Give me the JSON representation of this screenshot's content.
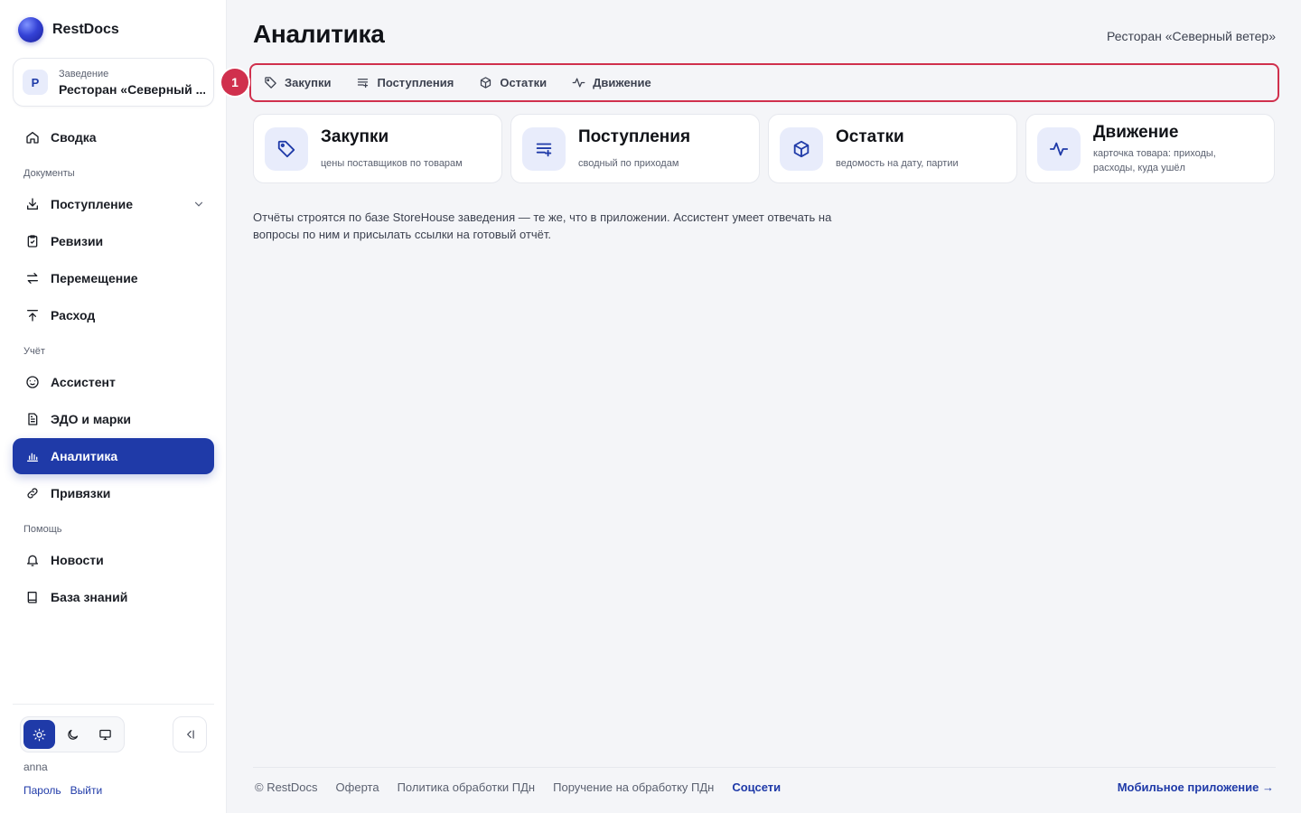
{
  "app": {
    "name": "RestDocs"
  },
  "venue": {
    "label": "Заведение",
    "avatar_letter": "Р",
    "name": "Ресторан «Северный ..."
  },
  "sidebar": {
    "summary": {
      "label": "Сводка",
      "icon": "home-icon"
    },
    "sections": {
      "documents": "Документы",
      "accounting": "Учёт",
      "help": "Помощь"
    },
    "items": [
      {
        "label": "Поступление",
        "icon": "download-icon"
      },
      {
        "label": "Ревизии",
        "icon": "clipboard-check-icon"
      },
      {
        "label": "Перемещение",
        "icon": "transfer-arrows-icon"
      },
      {
        "label": "Расход",
        "icon": "upload-icon"
      },
      {
        "label": "Ассистент",
        "icon": "assistant-icon"
      },
      {
        "label": "ЭДО и марки",
        "icon": "document-icon"
      },
      {
        "label": "Аналитика",
        "icon": "bar-chart-icon",
        "active": true
      },
      {
        "label": "Привязки",
        "icon": "link-icon"
      },
      {
        "label": "Новости",
        "icon": "bell-icon"
      },
      {
        "label": "База знаний",
        "icon": "book-icon"
      }
    ],
    "theme": {
      "selected": "light"
    },
    "user": {
      "name": "anna",
      "password_link": "Пароль",
      "logout_link": "Выйти"
    }
  },
  "header": {
    "title": "Аналитика",
    "venue_full": "Ресторан «Северный ветер»"
  },
  "tabs": [
    {
      "label": "Закупки",
      "icon": "tag-icon"
    },
    {
      "label": "Поступления",
      "icon": "list-plus-icon"
    },
    {
      "label": "Остатки",
      "icon": "box-icon"
    },
    {
      "label": "Движение",
      "icon": "activity-icon"
    }
  ],
  "annotation_marker": "1",
  "cards": [
    {
      "title": "Закупки",
      "subtitle": "цены поставщиков по товарам",
      "icon": "tag-icon"
    },
    {
      "title": "Поступления",
      "subtitle": "сводный по приходам",
      "icon": "list-plus-icon"
    },
    {
      "title": "Остатки",
      "subtitle": "ведомость на дату, партии",
      "icon": "box-icon"
    },
    {
      "title": "Движение",
      "subtitle": "карточка товара: приходы, расходы, куда ушёл",
      "icon": "activity-icon"
    }
  ],
  "info": "Отчёты строятся по базе StoreHouse заведения — те же, что в приложении. Ассистент умеет отвечать на вопросы по ним и присылать ссылки на готовый отчёт.",
  "footer": {
    "copyright": "© RestDocs",
    "links": [
      "Оферта",
      "Политика обработки ПДн",
      "Поручение на обработку ПДн"
    ],
    "social": "Соцсети",
    "mobile_app": "Мобильное приложение →"
  },
  "colors": {
    "accent": "#1f3aa8",
    "highlight": "#d0304d",
    "background": "#f4f5f8"
  }
}
